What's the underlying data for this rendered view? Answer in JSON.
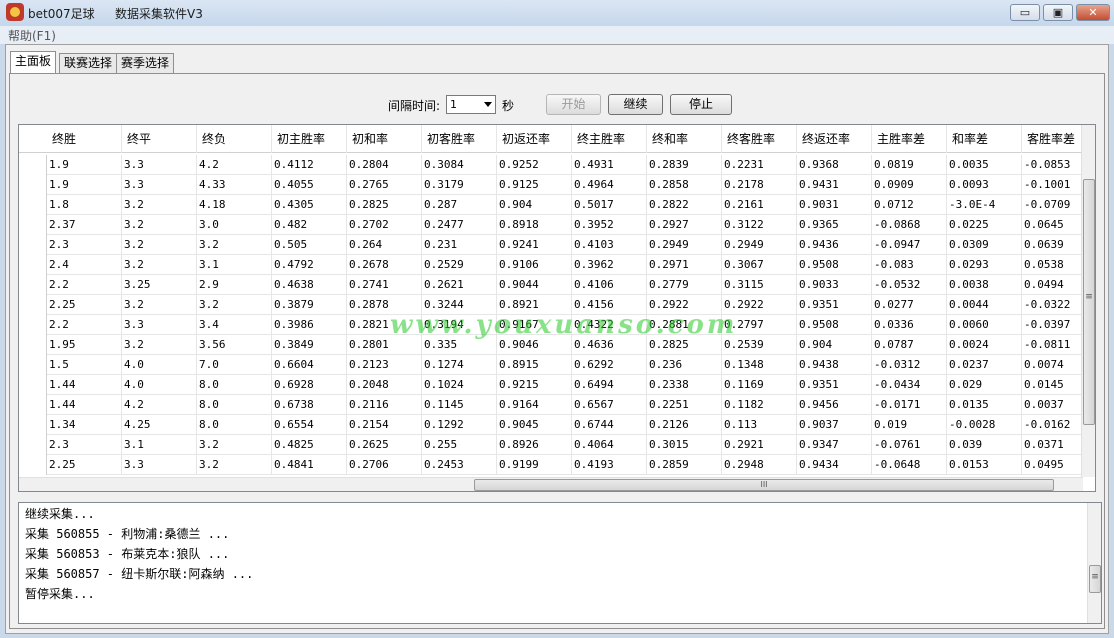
{
  "window": {
    "title": "bet007足球",
    "subtitle": "数据采集软件V3",
    "min_label": "▭",
    "max_label": "▣",
    "close_label": "✕"
  },
  "menu": {
    "help": "帮助(F1)"
  },
  "tabs": [
    {
      "label": "主面板",
      "active": true
    },
    {
      "label": "联赛选择",
      "active": false
    },
    {
      "label": "赛季选择",
      "active": false
    }
  ],
  "controls": {
    "interval_label": "间隔时间:",
    "interval_value": "1",
    "interval_unit": "秒",
    "start_label": "开始",
    "continue_label": "继续",
    "stop_label": "停止"
  },
  "grid": {
    "columns": [
      "终胜",
      "终平",
      "终负",
      "初主胜率",
      "初和率",
      "初客胜率",
      "初返还率",
      "终主胜率",
      "终和率",
      "终客胜率",
      "终返还率",
      "主胜率差",
      "和率差",
      "客胜率差"
    ],
    "rows": [
      [
        "1.9",
        "3.3",
        "4.2",
        "0.4112",
        "0.2804",
        "0.3084",
        "0.9252",
        "0.4931",
        "0.2839",
        "0.2231",
        "0.9368",
        "0.0819",
        "0.0035",
        "-0.0853"
      ],
      [
        "1.9",
        "3.3",
        "4.33",
        "0.4055",
        "0.2765",
        "0.3179",
        "0.9125",
        "0.4964",
        "0.2858",
        "0.2178",
        "0.9431",
        "0.0909",
        "0.0093",
        "-0.1001"
      ],
      [
        "1.8",
        "3.2",
        "4.18",
        "0.4305",
        "0.2825",
        "0.287",
        "0.904",
        "0.5017",
        "0.2822",
        "0.2161",
        "0.9031",
        "0.0712",
        "-3.0E-4",
        "-0.0709"
      ],
      [
        "2.37",
        "3.2",
        "3.0",
        "0.482",
        "0.2702",
        "0.2477",
        "0.8918",
        "0.3952",
        "0.2927",
        "0.3122",
        "0.9365",
        "-0.0868",
        "0.0225",
        "0.0645"
      ],
      [
        "2.3",
        "3.2",
        "3.2",
        "0.505",
        "0.264",
        "0.231",
        "0.9241",
        "0.4103",
        "0.2949",
        "0.2949",
        "0.9436",
        "-0.0947",
        "0.0309",
        "0.0639"
      ],
      [
        "2.4",
        "3.2",
        "3.1",
        "0.4792",
        "0.2678",
        "0.2529",
        "0.9106",
        "0.3962",
        "0.2971",
        "0.3067",
        "0.9508",
        "-0.083",
        "0.0293",
        "0.0538"
      ],
      [
        "2.2",
        "3.25",
        "2.9",
        "0.4638",
        "0.2741",
        "0.2621",
        "0.9044",
        "0.4106",
        "0.2779",
        "0.3115",
        "0.9033",
        "-0.0532",
        "0.0038",
        "0.0494"
      ],
      [
        "2.25",
        "3.2",
        "3.2",
        "0.3879",
        "0.2878",
        "0.3244",
        "0.8921",
        "0.4156",
        "0.2922",
        "0.2922",
        "0.9351",
        "0.0277",
        "0.0044",
        "-0.0322"
      ],
      [
        "2.2",
        "3.3",
        "3.4",
        "0.3986",
        "0.2821",
        "0.3194",
        "0.9167",
        "0.4322",
        "0.2881",
        "0.2797",
        "0.9508",
        "0.0336",
        "0.0060",
        "-0.0397"
      ],
      [
        "1.95",
        "3.2",
        "3.56",
        "0.3849",
        "0.2801",
        "0.335",
        "0.9046",
        "0.4636",
        "0.2825",
        "0.2539",
        "0.904",
        "0.0787",
        "0.0024",
        "-0.0811"
      ],
      [
        "1.5",
        "4.0",
        "7.0",
        "0.6604",
        "0.2123",
        "0.1274",
        "0.8915",
        "0.6292",
        "0.236",
        "0.1348",
        "0.9438",
        "-0.0312",
        "0.0237",
        "0.0074"
      ],
      [
        "1.44",
        "4.0",
        "8.0",
        "0.6928",
        "0.2048",
        "0.1024",
        "0.9215",
        "0.6494",
        "0.2338",
        "0.1169",
        "0.9351",
        "-0.0434",
        "0.029",
        "0.0145"
      ],
      [
        "1.44",
        "4.2",
        "8.0",
        "0.6738",
        "0.2116",
        "0.1145",
        "0.9164",
        "0.6567",
        "0.2251",
        "0.1182",
        "0.9456",
        "-0.0171",
        "0.0135",
        "0.0037"
      ],
      [
        "1.34",
        "4.25",
        "8.0",
        "0.6554",
        "0.2154",
        "0.1292",
        "0.9045",
        "0.6744",
        "0.2126",
        "0.113",
        "0.9037",
        "0.019",
        "-0.0028",
        "-0.0162"
      ],
      [
        "2.3",
        "3.1",
        "3.2",
        "0.4825",
        "0.2625",
        "0.255",
        "0.8926",
        "0.4064",
        "0.3015",
        "0.2921",
        "0.9347",
        "-0.0761",
        "0.039",
        "0.0371"
      ],
      [
        "2.25",
        "3.3",
        "3.2",
        "0.4841",
        "0.2706",
        "0.2453",
        "0.9199",
        "0.4193",
        "0.2859",
        "0.2948",
        "0.9434",
        "-0.0648",
        "0.0153",
        "0.0495"
      ]
    ],
    "hscroll_label": "III",
    "vscroll_label": "≡"
  },
  "log": {
    "lines": [
      "继续采集...",
      "采集 560855 - 利物浦:桑德兰 ...",
      "采集 560853 - 布莱克本:狼队 ...",
      "采集 560857 - 纽卡斯尔联:阿森纳 ...",
      "暂停采集..."
    ],
    "scroll_label": "≡"
  },
  "watermark": "www.youxuanso.com",
  "colors": {
    "titlebar": "#c5d7ec",
    "watermark": "#28c828",
    "close": "#c44d31"
  }
}
